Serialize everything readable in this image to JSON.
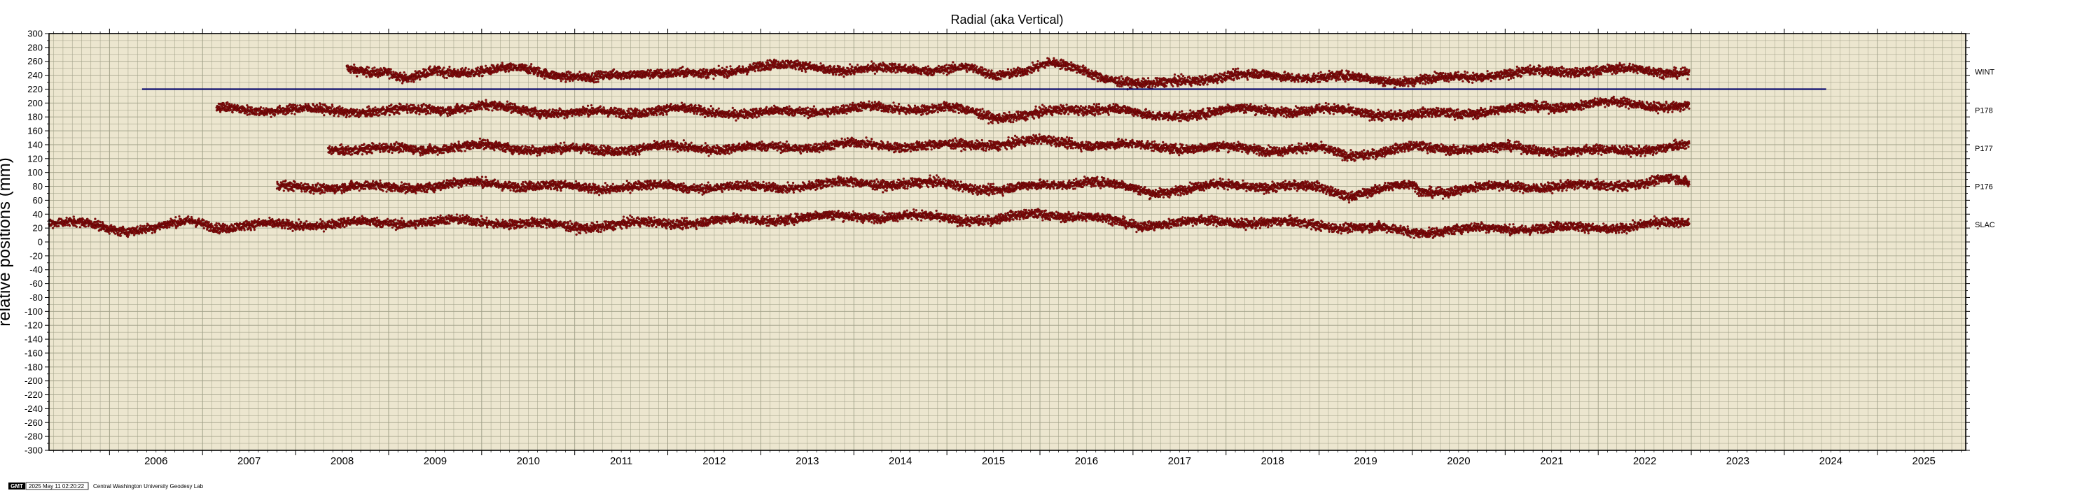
{
  "chart_data": {
    "type": "scatter",
    "title": "Radial (aka Vertical)",
    "xlabel": "",
    "ylabel": "relative positions (mm)",
    "xlim": [
      2005.35,
      2025.95
    ],
    "ylim": [
      -300,
      300
    ],
    "yticks": [
      300,
      280,
      260,
      240,
      220,
      200,
      180,
      160,
      140,
      120,
      100,
      80,
      60,
      40,
      20,
      0,
      -20,
      -40,
      -60,
      -80,
      -100,
      -120,
      -140,
      -160,
      -180,
      -200,
      -220,
      -240,
      -260,
      -280,
      -300
    ],
    "xticks": [
      "2006",
      "2007",
      "2008",
      "2009",
      "2010",
      "2011",
      "2012",
      "2013",
      "2014",
      "2015",
      "2016",
      "2017",
      "2018",
      "2019",
      "2020",
      "2021",
      "2022",
      "2023",
      "2024",
      "2025"
    ],
    "grid": true,
    "reference_line": {
      "y": 220,
      "x_start": 2006.35,
      "x_end": 2024.45,
      "color": "#0a0a6e"
    },
    "series": [
      {
        "name": "WINT",
        "x_start": 2008.55,
        "x_end": 2022.98,
        "baseline": 240,
        "spread": 6,
        "trend": [
          [
            2008.55,
            250
          ],
          [
            2009.0,
            245
          ],
          [
            2009.2,
            232
          ],
          [
            2009.5,
            245
          ],
          [
            2010.5,
            248
          ],
          [
            2011.2,
            235
          ],
          [
            2011.8,
            245
          ],
          [
            2012.4,
            240
          ],
          [
            2013.0,
            255
          ],
          [
            2014.0,
            248
          ],
          [
            2015.2,
            250
          ],
          [
            2015.5,
            238
          ],
          [
            2016.1,
            258
          ],
          [
            2016.6,
            240
          ],
          [
            2017.2,
            225
          ],
          [
            2018.0,
            240
          ],
          [
            2019.0,
            238
          ],
          [
            2020.0,
            232
          ],
          [
            2021.0,
            242
          ],
          [
            2022.0,
            248
          ],
          [
            2022.98,
            245
          ]
        ]
      },
      {
        "name": "P178",
        "x_start": 2007.15,
        "x_end": 2022.98,
        "baseline": 190,
        "spread": 6,
        "trend": [
          [
            2007.15,
            192
          ],
          [
            2008.0,
            190
          ],
          [
            2009.0,
            188
          ],
          [
            2010.0,
            195
          ],
          [
            2011.0,
            185
          ],
          [
            2012.0,
            190
          ],
          [
            2013.0,
            185
          ],
          [
            2014.0,
            192
          ],
          [
            2015.0,
            193
          ],
          [
            2015.5,
            180
          ],
          [
            2016.0,
            185
          ],
          [
            2016.8,
            195
          ],
          [
            2017.2,
            178
          ],
          [
            2018.0,
            190
          ],
          [
            2019.0,
            190
          ],
          [
            2020.0,
            182
          ],
          [
            2021.0,
            190
          ],
          [
            2022.0,
            200
          ],
          [
            2022.98,
            195
          ]
        ]
      },
      {
        "name": "P177",
        "x_start": 2008.35,
        "x_end": 2022.98,
        "baseline": 135,
        "spread": 6,
        "trend": [
          [
            2008.35,
            135
          ],
          [
            2009.0,
            133
          ],
          [
            2010.0,
            138
          ],
          [
            2011.0,
            132
          ],
          [
            2012.0,
            136
          ],
          [
            2013.0,
            135
          ],
          [
            2014.0,
            140
          ],
          [
            2015.0,
            138
          ],
          [
            2016.0,
            145
          ],
          [
            2017.0,
            138
          ],
          [
            2018.0,
            135
          ],
          [
            2019.0,
            133
          ],
          [
            2019.3,
            125
          ],
          [
            2020.0,
            135
          ],
          [
            2021.0,
            135
          ],
          [
            2022.0,
            130
          ],
          [
            2022.98,
            138
          ]
        ]
      },
      {
        "name": "P176",
        "x_start": 2007.8,
        "x_end": 2022.98,
        "baseline": 80,
        "spread": 6,
        "trend": [
          [
            2007.8,
            78
          ],
          [
            2008.5,
            80
          ],
          [
            2009.0,
            78
          ],
          [
            2010.0,
            85
          ],
          [
            2011.0,
            78
          ],
          [
            2012.0,
            80
          ],
          [
            2013.0,
            78
          ],
          [
            2014.0,
            85
          ],
          [
            2015.0,
            83
          ],
          [
            2015.6,
            75
          ],
          [
            2016.5,
            88
          ],
          [
            2017.2,
            72
          ],
          [
            2018.0,
            82
          ],
          [
            2019.0,
            78
          ],
          [
            2019.3,
            68
          ],
          [
            2020.0,
            82
          ],
          [
            2020.1,
            72
          ],
          [
            2021.0,
            80
          ],
          [
            2022.0,
            80
          ],
          [
            2022.8,
            90
          ],
          [
            2022.98,
            82
          ]
        ]
      },
      {
        "name": "SLAC",
        "x_start": 2005.35,
        "x_end": 2022.98,
        "baseline": 25,
        "spread": 6,
        "trend": [
          [
            2005.35,
            28
          ],
          [
            2005.8,
            25
          ],
          [
            2006.1,
            18
          ],
          [
            2006.5,
            20
          ],
          [
            2006.9,
            30
          ],
          [
            2007.2,
            22
          ],
          [
            2008.0,
            25
          ],
          [
            2009.0,
            28
          ],
          [
            2010.0,
            30
          ],
          [
            2011.0,
            22
          ],
          [
            2012.0,
            28
          ],
          [
            2013.0,
            32
          ],
          [
            2014.0,
            38
          ],
          [
            2015.0,
            35
          ],
          [
            2015.5,
            30
          ],
          [
            2016.0,
            42
          ],
          [
            2016.7,
            32
          ],
          [
            2017.0,
            25
          ],
          [
            2018.0,
            30
          ],
          [
            2019.0,
            25
          ],
          [
            2020.0,
            15
          ],
          [
            2021.0,
            20
          ],
          [
            2022.0,
            20
          ],
          [
            2022.98,
            28
          ]
        ]
      }
    ]
  },
  "footer": {
    "gmt_logo": "GMT",
    "timestamp": "2025 May 11 02:20:22",
    "credit": "Central Washington University Geodesy Lab"
  },
  "colors": {
    "background": "#ece6cf",
    "grid": "#9e9e86",
    "points": "#8b0d0d",
    "point_edge": "#3a0000",
    "reference_line": "#0a0a6e"
  }
}
